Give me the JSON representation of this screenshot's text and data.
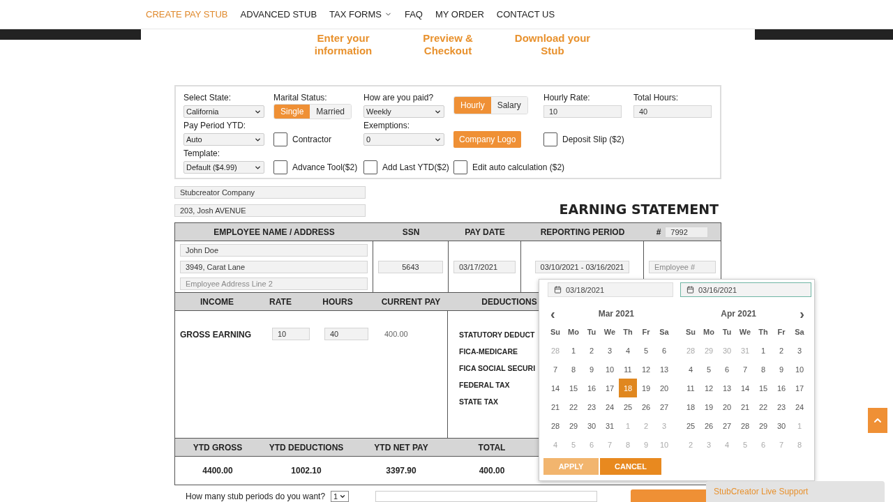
{
  "nav": [
    {
      "label": "CREATE PAY STUB",
      "selected": true,
      "dropdown": false
    },
    {
      "label": "ADVANCED STUB",
      "selected": false,
      "dropdown": false
    },
    {
      "label": "TAX FORMS",
      "selected": false,
      "dropdown": true
    },
    {
      "label": "FAQ",
      "selected": false,
      "dropdown": false
    },
    {
      "label": "MY ORDER",
      "selected": false,
      "dropdown": false
    },
    {
      "label": "CONTACT US",
      "selected": false,
      "dropdown": false
    }
  ],
  "steps": [
    "Enter your information",
    "Preview & Checkout",
    "Download your Stub"
  ],
  "form": {
    "state": {
      "label": "Select State:",
      "value": "California"
    },
    "marital": {
      "label": "Marital Status:",
      "options": [
        {
          "label": "Single",
          "selected": true
        },
        {
          "label": "Married",
          "selected": false
        }
      ]
    },
    "paid": {
      "label": "How are you paid?",
      "value": "Weekly"
    },
    "pay_type": {
      "options": [
        {
          "label": "Hourly",
          "selected": true
        },
        {
          "label": "Salary",
          "selected": false
        }
      ]
    },
    "hourly_rate": {
      "label": "Hourly Rate:",
      "value": "10"
    },
    "total_hours": {
      "label": "Total Hours:",
      "value": "40"
    },
    "pay_period_ytd": {
      "label": "Pay Period YTD:",
      "value": "Auto"
    },
    "contractor": {
      "label": "Contractor",
      "checked": false
    },
    "exemptions": {
      "label": "Exemptions:",
      "value": "0"
    },
    "company_logo": "Company Logo",
    "deposit_slip": {
      "label": "Deposit Slip ($2)",
      "checked": false
    },
    "template": {
      "label": "Template:",
      "value": "Default ($4.99)"
    },
    "advance_tool": {
      "label": "Advance Tool($2)",
      "checked": false
    },
    "add_last_ytd": {
      "label": "Add Last YTD($2)",
      "checked": false
    },
    "edit_auto": {
      "label": "Edit auto calculation ($2)",
      "checked": false
    }
  },
  "company": {
    "name": "Stubcreator Company",
    "address": "203, Josh AVENUE"
  },
  "statement_title": "EARNING STATEMENT",
  "employee_table": {
    "columns": [
      "EMPLOYEE NAME / ADDRESS",
      "SSN",
      "PAY DATE",
      "REPORTING PERIOD",
      "#"
    ],
    "number": "7992",
    "name": "John Doe",
    "address1": "3949, Carat Lane",
    "address2_placeholder": "Employee Address Line 2",
    "ssn": "5643",
    "pay_date": "03/17/2021",
    "period": "03/10/2021 - 03/16/2021",
    "employee_placeholder": "Employee #"
  },
  "income": {
    "columns": [
      "INCOME",
      "RATE",
      "HOURS",
      "CURRENT PAY"
    ],
    "deductions_heading": "DEDUCTIONS",
    "row": {
      "label": "GROSS EARNING",
      "rate": "10",
      "hours": "40",
      "current": "400.00"
    },
    "deductions": [
      "STATUTORY DEDUCT",
      "FICA-MEDICARE",
      "FICA SOCIAL SECURI",
      "FEDERAL TAX",
      "STATE TAX"
    ]
  },
  "ytd": {
    "columns": [
      "YTD GROSS",
      "YTD DEDUCTIONS",
      "YTD NET PAY",
      "TOTAL"
    ],
    "values": [
      "4400.00",
      "1002.10",
      "3397.90",
      "400.00"
    ]
  },
  "datepicker": {
    "fields": [
      {
        "value": "03/18/2021",
        "focused": false
      },
      {
        "value": "03/16/2021",
        "focused": true
      }
    ],
    "months": [
      {
        "title": "Mar 2021",
        "arrow": "‹",
        "weekdays": [
          "Su",
          "Mo",
          "Tu",
          "We",
          "Th",
          "Fr",
          "Sa"
        ],
        "days": [
          {
            "label": "28",
            "muted": true,
            "selected": false
          },
          {
            "label": "1",
            "muted": false,
            "selected": false
          },
          {
            "label": "2",
            "muted": false,
            "selected": false
          },
          {
            "label": "3",
            "muted": false,
            "selected": false
          },
          {
            "label": "4",
            "muted": false,
            "selected": false
          },
          {
            "label": "5",
            "muted": false,
            "selected": false
          },
          {
            "label": "6",
            "muted": false,
            "selected": false
          },
          {
            "label": "7",
            "muted": false,
            "selected": false
          },
          {
            "label": "8",
            "muted": false,
            "selected": false
          },
          {
            "label": "9",
            "muted": false,
            "selected": false
          },
          {
            "label": "10",
            "muted": false,
            "selected": false
          },
          {
            "label": "11",
            "muted": false,
            "selected": false
          },
          {
            "label": "12",
            "muted": false,
            "selected": false
          },
          {
            "label": "13",
            "muted": false,
            "selected": false
          },
          {
            "label": "14",
            "muted": false,
            "selected": false
          },
          {
            "label": "15",
            "muted": false,
            "selected": false
          },
          {
            "label": "16",
            "muted": false,
            "selected": false
          },
          {
            "label": "17",
            "muted": false,
            "selected": false
          },
          {
            "label": "18",
            "muted": false,
            "selected": true
          },
          {
            "label": "19",
            "muted": false,
            "selected": false
          },
          {
            "label": "20",
            "muted": false,
            "selected": false
          },
          {
            "label": "21",
            "muted": false,
            "selected": false
          },
          {
            "label": "22",
            "muted": false,
            "selected": false
          },
          {
            "label": "23",
            "muted": false,
            "selected": false
          },
          {
            "label": "24",
            "muted": false,
            "selected": false
          },
          {
            "label": "25",
            "muted": false,
            "selected": false
          },
          {
            "label": "26",
            "muted": false,
            "selected": false
          },
          {
            "label": "27",
            "muted": false,
            "selected": false
          },
          {
            "label": "28",
            "muted": false,
            "selected": false
          },
          {
            "label": "29",
            "muted": false,
            "selected": false
          },
          {
            "label": "30",
            "muted": false,
            "selected": false
          },
          {
            "label": "31",
            "muted": false,
            "selected": false
          },
          {
            "label": "1",
            "muted": true,
            "selected": false
          },
          {
            "label": "2",
            "muted": true,
            "selected": false
          },
          {
            "label": "3",
            "muted": true,
            "selected": false
          },
          {
            "label": "4",
            "muted": true,
            "selected": false
          },
          {
            "label": "5",
            "muted": true,
            "selected": false
          },
          {
            "label": "6",
            "muted": true,
            "selected": false
          },
          {
            "label": "7",
            "muted": true,
            "selected": false
          },
          {
            "label": "8",
            "muted": true,
            "selected": false
          },
          {
            "label": "9",
            "muted": true,
            "selected": false
          },
          {
            "label": "10",
            "muted": true,
            "selected": false
          }
        ]
      },
      {
        "title": "Apr 2021",
        "arrow": "›",
        "weekdays": [
          "Su",
          "Mo",
          "Tu",
          "We",
          "Th",
          "Fr",
          "Sa"
        ],
        "days": [
          {
            "label": "28",
            "muted": true,
            "selected": false
          },
          {
            "label": "29",
            "muted": true,
            "selected": false
          },
          {
            "label": "30",
            "muted": true,
            "selected": false
          },
          {
            "label": "31",
            "muted": true,
            "selected": false
          },
          {
            "label": "1",
            "muted": false,
            "selected": false
          },
          {
            "label": "2",
            "muted": false,
            "selected": false
          },
          {
            "label": "3",
            "muted": false,
            "selected": false
          },
          {
            "label": "4",
            "muted": false,
            "selected": false
          },
          {
            "label": "5",
            "muted": false,
            "selected": false
          },
          {
            "label": "6",
            "muted": false,
            "selected": false
          },
          {
            "label": "7",
            "muted": false,
            "selected": false
          },
          {
            "label": "8",
            "muted": false,
            "selected": false
          },
          {
            "label": "9",
            "muted": false,
            "selected": false
          },
          {
            "label": "10",
            "muted": false,
            "selected": false
          },
          {
            "label": "11",
            "muted": false,
            "selected": false
          },
          {
            "label": "12",
            "muted": false,
            "selected": false
          },
          {
            "label": "13",
            "muted": false,
            "selected": false
          },
          {
            "label": "14",
            "muted": false,
            "selected": false
          },
          {
            "label": "15",
            "muted": false,
            "selected": false
          },
          {
            "label": "16",
            "muted": false,
            "selected": false
          },
          {
            "label": "17",
            "muted": false,
            "selected": false
          },
          {
            "label": "18",
            "muted": false,
            "selected": false
          },
          {
            "label": "19",
            "muted": false,
            "selected": false
          },
          {
            "label": "20",
            "muted": false,
            "selected": false
          },
          {
            "label": "21",
            "muted": false,
            "selected": false
          },
          {
            "label": "22",
            "muted": false,
            "selected": false
          },
          {
            "label": "23",
            "muted": false,
            "selected": false
          },
          {
            "label": "24",
            "muted": false,
            "selected": false
          },
          {
            "label": "25",
            "muted": false,
            "selected": false
          },
          {
            "label": "26",
            "muted": false,
            "selected": false
          },
          {
            "label": "27",
            "muted": false,
            "selected": false
          },
          {
            "label": "28",
            "muted": false,
            "selected": false
          },
          {
            "label": "29",
            "muted": false,
            "selected": false
          },
          {
            "label": "30",
            "muted": false,
            "selected": false
          },
          {
            "label": "1",
            "muted": true,
            "selected": false
          },
          {
            "label": "2",
            "muted": true,
            "selected": false
          },
          {
            "label": "3",
            "muted": true,
            "selected": false
          },
          {
            "label": "4",
            "muted": true,
            "selected": false
          },
          {
            "label": "5",
            "muted": true,
            "selected": false
          },
          {
            "label": "6",
            "muted": true,
            "selected": false
          },
          {
            "label": "7",
            "muted": true,
            "selected": false
          },
          {
            "label": "8",
            "muted": true,
            "selected": false
          }
        ]
      }
    ],
    "buttons": [
      {
        "label": "APPLY",
        "disabled": true
      },
      {
        "label": "CANCEL",
        "disabled": false
      }
    ]
  },
  "stub_periods": {
    "label": "How many stub periods do you want?",
    "value": "1"
  },
  "live_support": "StubCreator Live Support"
}
